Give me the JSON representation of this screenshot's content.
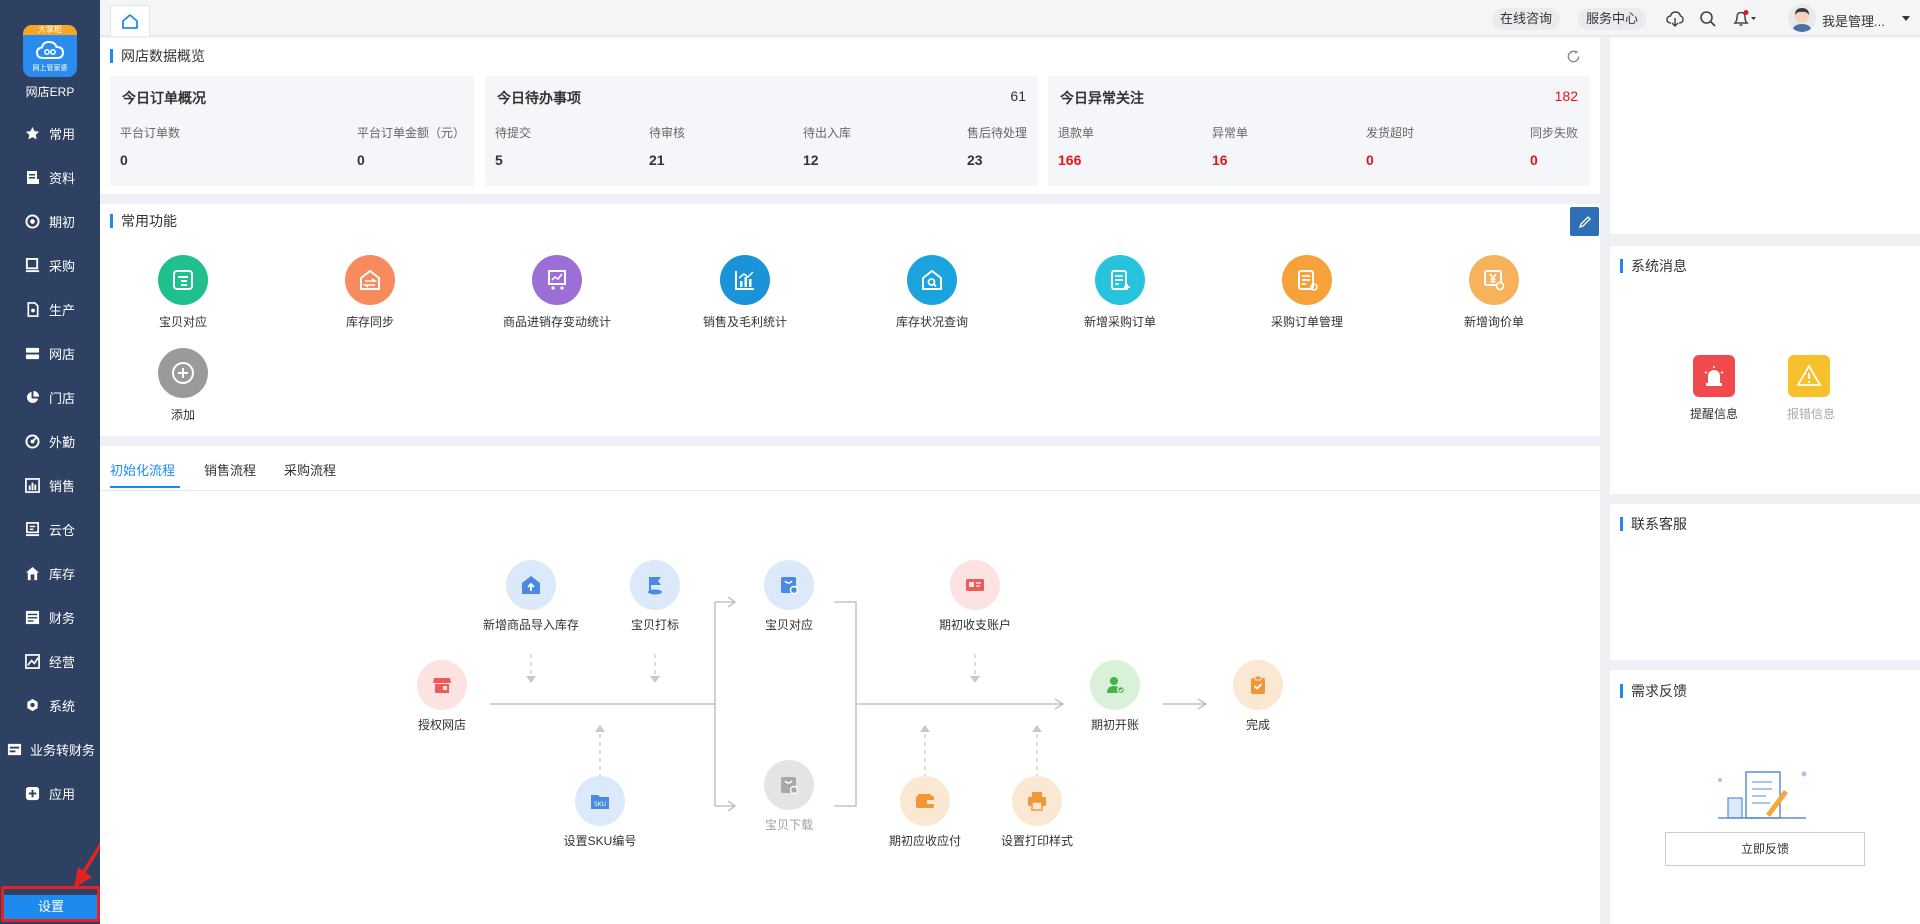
{
  "app": {
    "name": "网店ERP",
    "logo_badge": "大掌柜",
    "logo_subtitle": "网上管家婆"
  },
  "sidebar": {
    "items": [
      {
        "label": "常用",
        "icon": "star-icon"
      },
      {
        "label": "资料",
        "icon": "document-icon"
      },
      {
        "label": "期初",
        "icon": "target-icon"
      },
      {
        "label": "采购",
        "icon": "monitor-icon"
      },
      {
        "label": "生产",
        "icon": "file-icon"
      },
      {
        "label": "网店",
        "icon": "server-icon"
      },
      {
        "label": "门店",
        "icon": "pie-icon"
      },
      {
        "label": "外勤",
        "icon": "radar-icon"
      },
      {
        "label": "销售",
        "icon": "chart-icon"
      },
      {
        "label": "云仓",
        "icon": "board-icon"
      },
      {
        "label": "库存",
        "icon": "house-icon"
      },
      {
        "label": "财务",
        "icon": "ledger-icon"
      },
      {
        "label": "经营",
        "icon": "trend-icon"
      },
      {
        "label": "系统",
        "icon": "gear-icon"
      },
      {
        "label": "业务转财务",
        "icon": "transfer-icon"
      },
      {
        "label": "应用",
        "icon": "plus-box-icon"
      }
    ],
    "settings_label": "设置"
  },
  "topbar": {
    "online_consult": "在线咨询",
    "service_center": "服务中心",
    "user_name": "我是管理..."
  },
  "overview": {
    "title": "网店数据概览",
    "orders": {
      "title": "今日订单概况",
      "labels": [
        "平台订单数",
        "平台订单金额（元）"
      ],
      "values": [
        "0",
        "0"
      ]
    },
    "todo": {
      "title": "今日待办事项",
      "count": "61",
      "labels": [
        "待提交",
        "待审核",
        "待出入库",
        "售后待处理"
      ],
      "values": [
        "5",
        "21",
        "12",
        "23"
      ]
    },
    "abnormal": {
      "title": "今日异常关注",
      "count": "182",
      "labels": [
        "退款单",
        "异常单",
        "发货超时",
        "同步失败"
      ],
      "values": [
        "166",
        "16",
        "0",
        "0"
      ]
    }
  },
  "functions": {
    "title": "常用功能",
    "items": [
      {
        "label": "宝贝对应",
        "color": "#1fbf8e"
      },
      {
        "label": "库存同步",
        "color": "#f78b5e"
      },
      {
        "label": "商品进销存变动统计",
        "color": "#9b6fd6"
      },
      {
        "label": "销售及毛利统计",
        "color": "#1a93d9"
      },
      {
        "label": "库存状况查询",
        "color": "#1aa3dd"
      },
      {
        "label": "新增采购订单",
        "color": "#27c3dd"
      },
      {
        "label": "采购订单管理",
        "color": "#f6a13a"
      },
      {
        "label": "新增询价单",
        "color": "#f7b25c"
      },
      {
        "label": "添加",
        "color": "#9a9a9a"
      }
    ]
  },
  "process": {
    "tabs": [
      "初始化流程",
      "销售流程",
      "采购流程"
    ],
    "nodes": {
      "authorize": "授权网店",
      "import_stock": "新增商品导入库存",
      "mark": "宝贝打标",
      "sku": "设置SKU编号",
      "match": "宝贝对应",
      "download": "宝贝下载",
      "init_account": "期初收支账户",
      "init_payable": "期初应收应付",
      "print_style": "设置打印样式",
      "open_account": "期初开账",
      "done": "完成"
    }
  },
  "right": {
    "messages_title": "系统消息",
    "reminder": "提醒信息",
    "alarm": "报错信息",
    "contact_title": "联系客服",
    "feedback_title": "需求反馈",
    "feedback_button": "立即反馈"
  }
}
